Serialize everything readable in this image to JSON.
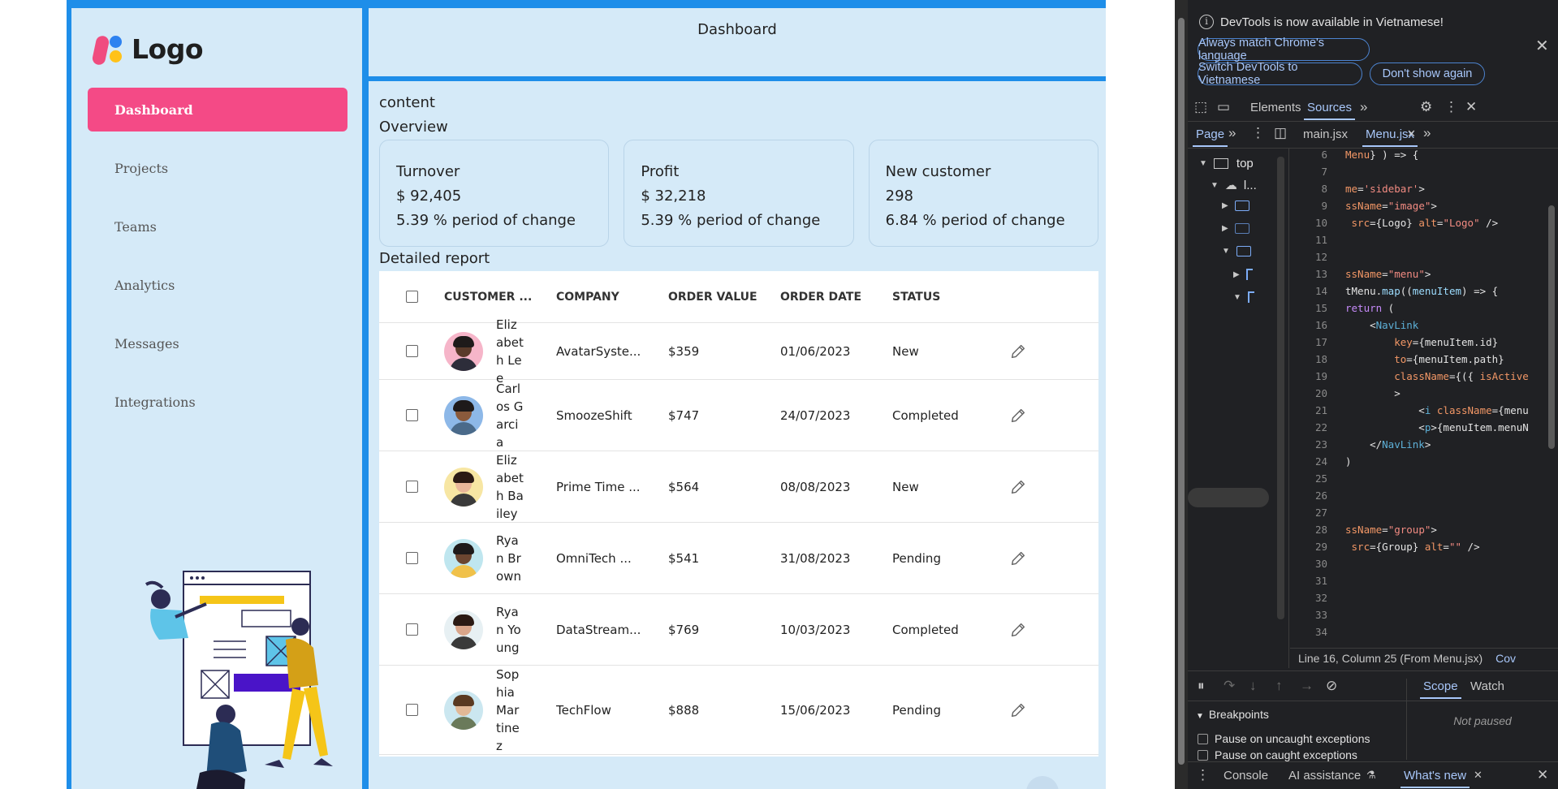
{
  "app": {
    "logo_text": "Logo",
    "menu": [
      {
        "label": "Dashboard",
        "active": true
      },
      {
        "label": "Projects"
      },
      {
        "label": "Teams"
      },
      {
        "label": "Analytics"
      },
      {
        "label": "Messages"
      },
      {
        "label": "Integrations"
      }
    ],
    "header_title": "Dashboard",
    "content_label": "content",
    "overview_label": "Overview",
    "cards": [
      {
        "title": "Turnover",
        "value": "$ 92,405",
        "change": "5.39 % period of change"
      },
      {
        "title": "Profit",
        "value": "$ 32,218",
        "change": "5.39 % period of change"
      },
      {
        "title": "New customer",
        "value": "298",
        "change": "6.84 % period of change"
      }
    ],
    "detailed_label": "Detailed report",
    "table": {
      "headers": [
        "CUSTOMER ...",
        "COMPANY",
        "ORDER VALUE",
        "ORDER DATE",
        "STATUS"
      ],
      "rows": [
        {
          "name": "Elizabeth Lee",
          "company": "AvatarSyste...",
          "value": "$359",
          "date": "01/06/2023",
          "status": "New",
          "avatar_bg": "#f6b5c9",
          "skin": "#5a3a2a",
          "hair": "#1e1a1a",
          "shirt": "#2d2d3a"
        },
        {
          "name": "Carlos Garcia",
          "company": "SmoozeShift",
          "value": "$747",
          "date": "24/07/2023",
          "status": "Completed",
          "avatar_bg": "#8db8e8",
          "skin": "#8a5a3c",
          "hair": "#1e1a1a",
          "shirt": "#4a6a8a"
        },
        {
          "name": "Elizabeth Bailey",
          "company": "Prime Time ...",
          "value": "$564",
          "date": "08/08/2023",
          "status": "New",
          "avatar_bg": "#f7e6a3",
          "skin": "#e9b79a",
          "hair": "#2b1a14",
          "shirt": "#3a3a3a"
        },
        {
          "name": "Ryan Brown",
          "company": "OmniTech ...",
          "value": "$541",
          "date": "31/08/2023",
          "status": "Pending",
          "avatar_bg": "#bfe6ef",
          "skin": "#6b4530",
          "hair": "#1e1a1a",
          "shirt": "#f0c14a"
        },
        {
          "name": "Ryan Young",
          "company": "DataStream...",
          "value": "$769",
          "date": "10/03/2023",
          "status": "Completed",
          "avatar_bg": "#e7f0f3",
          "skin": "#d9a58a",
          "hair": "#2b1a14",
          "shirt": "#3a3a3a"
        },
        {
          "name": "Sophia Martinez",
          "company": "TechFlow",
          "value": "$888",
          "date": "15/06/2023",
          "status": "Pending",
          "avatar_bg": "#cbe7f0",
          "skin": "#e2b896",
          "hair": "#5a3a22",
          "shirt": "#6a7a5a"
        }
      ]
    }
  },
  "devtools": {
    "info_text": "DevTools is now available in Vietnamese!",
    "btn_match": "Always match Chrome's language",
    "btn_switch": "Switch DevTools to Vietnamese",
    "btn_dont": "Don't show again",
    "tab_elements": "Elements",
    "tab_sources": "Sources",
    "nav_page": "Page",
    "file_main": "main.jsx",
    "file_menu": "Menu.jsx",
    "tree_top": "top",
    "tree_l": "l...",
    "status_text": "Line 16, Column 25 (From Menu.jsx)",
    "status_cov": "Cov",
    "scope": "Scope",
    "watch": "Watch",
    "not_paused": "Not paused",
    "breakpoints": "Breakpoints",
    "pause_uncaught": "Pause on uncaught exceptions",
    "pause_caught": "Pause on caught exceptions",
    "drawer_console": "Console",
    "drawer_ai": "AI assistance",
    "drawer_whats_new": "What's new"
  }
}
